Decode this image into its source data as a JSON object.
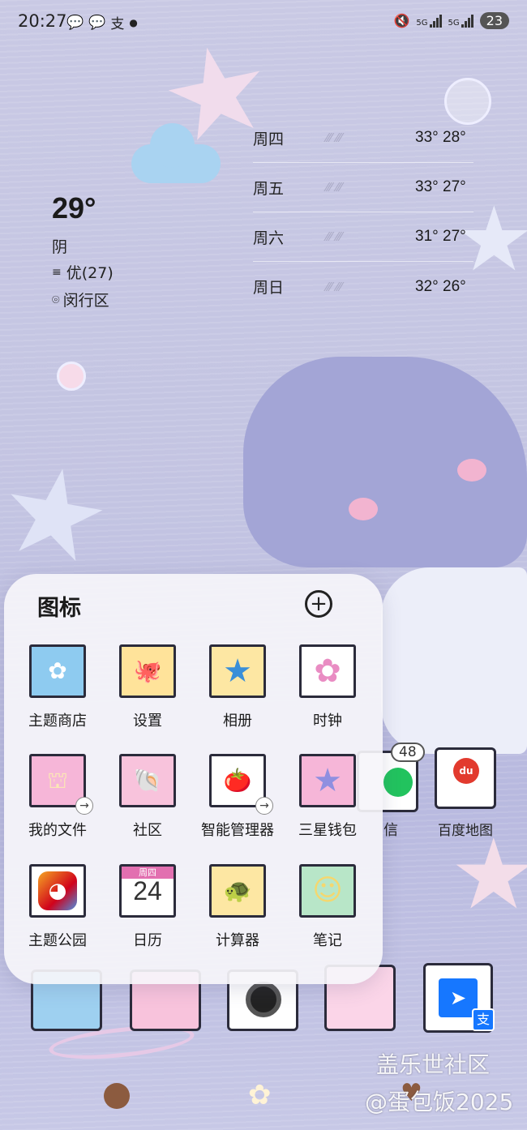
{
  "status_bar": {
    "time": "20:27",
    "left_icons": [
      "wechat-icon",
      "wechat-icon",
      "alipay-icon",
      "dot"
    ],
    "alipay_glyph": "支",
    "net_1": "5G",
    "net_2": "5G",
    "battery": "23"
  },
  "weather": {
    "current_temp": "29°",
    "condition": "阴",
    "aqi": "优(27)",
    "location": "闵行区",
    "forecast": [
      {
        "day": "周四",
        "hilo": "33° 28°"
      },
      {
        "day": "周五",
        "hilo": "33° 27°"
      },
      {
        "day": "周六",
        "hilo": "31° 27°"
      },
      {
        "day": "周日",
        "hilo": "32° 26°"
      }
    ]
  },
  "folder": {
    "title": "图标",
    "apps": [
      {
        "label": "主题商店",
        "color": "#8ecbf0",
        "glyph": "✿"
      },
      {
        "label": "设置",
        "color": "#ffe39a",
        "glyph": "🐙"
      },
      {
        "label": "相册",
        "color": "#fde7a3",
        "glyph": "★"
      },
      {
        "label": "时钟",
        "color": "#ffffff",
        "glyph": "✿"
      },
      {
        "label": "我的文件",
        "color": "#f6b6d8",
        "glyph": "⛫"
      },
      {
        "label": "社区",
        "color": "#f8c3dc",
        "glyph": "🐚"
      },
      {
        "label": "智能管理器",
        "color": "#ffffff",
        "glyph": "🍅"
      },
      {
        "label": "三星钱包",
        "color": "#f6b6d8",
        "glyph": "★"
      },
      {
        "label": "主题公园",
        "color": "#ffffff",
        "glyph": "◕"
      },
      {
        "label": "日历",
        "color": "#ffffff",
        "cal_day": "周四",
        "cal_num": "24"
      },
      {
        "label": "计算器",
        "color": "#fde7a3",
        "glyph": "🐢"
      },
      {
        "label": "笔记",
        "color": "#b8e6c8",
        "glyph": "☺"
      }
    ]
  },
  "background_apps": {
    "wechat_badge": "48",
    "wechat_label_partial": "信",
    "baidu_label": "百度地图",
    "baidu_logo": "du",
    "alipay_glyph": "支"
  },
  "watermark": {
    "line1": "盖乐世社区",
    "line2": "@蛋包饭2025"
  }
}
